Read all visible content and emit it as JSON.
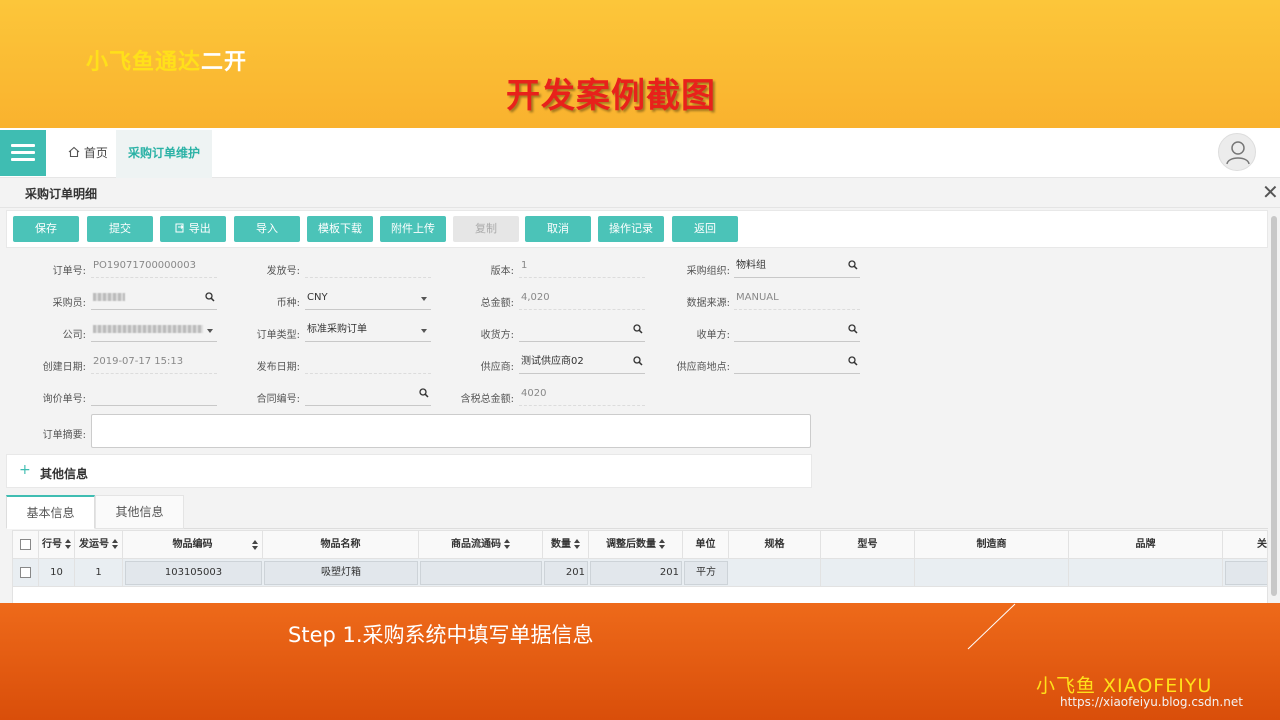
{
  "slide": {
    "brand_yellow": "小飞鱼通达",
    "brand_white": "二开",
    "title": "开发案例截图",
    "step_text": "Step 1.采购系统中填写单据信息",
    "bottom_brand": "小飞鱼  XIAOFEIYU",
    "watermark": "https://xiaofeiyu.blog.csdn.net"
  },
  "nav": {
    "home": "首页",
    "active_tab": "采购订单维护"
  },
  "page": {
    "title": "采购订单明细"
  },
  "toolbar": {
    "buttons": [
      {
        "label": "保存",
        "disabled": false
      },
      {
        "label": "提交",
        "disabled": false
      },
      {
        "label": "导出",
        "disabled": false
      },
      {
        "label": "导入",
        "disabled": false
      },
      {
        "label": "模板下载",
        "disabled": false
      },
      {
        "label": "附件上传",
        "disabled": false
      },
      {
        "label": "复制",
        "disabled": true
      },
      {
        "label": "取消",
        "disabled": false
      },
      {
        "label": "操作记录",
        "disabled": false
      },
      {
        "label": "返回",
        "disabled": false
      }
    ]
  },
  "form": {
    "order_no": {
      "label": "订单号:",
      "value": "PO19071700000003"
    },
    "release_no": {
      "label": "发放号:",
      "value": ""
    },
    "version": {
      "label": "版本:",
      "value": "1"
    },
    "purchase_org": {
      "label": "采购组织:",
      "value": "物料组"
    },
    "buyer": {
      "label": "采购员:",
      "value": ""
    },
    "currency": {
      "label": "币种:",
      "value": "CNY"
    },
    "total_amount": {
      "label": "总金额:",
      "value": "4,020"
    },
    "data_source": {
      "label": "数据来源:",
      "value": "MANUAL"
    },
    "company": {
      "label": "公司:",
      "value": ""
    },
    "order_type": {
      "label": "订单类型:",
      "value": "标准采购订单"
    },
    "receiver": {
      "label": "收货方:",
      "value": ""
    },
    "bill_to": {
      "label": "收单方:",
      "value": ""
    },
    "created_date": {
      "label": "创建日期:",
      "value": "2019-07-17 15:13"
    },
    "publish_date": {
      "label": "发布日期:",
      "value": ""
    },
    "supplier": {
      "label": "供应商:",
      "value": "测试供应商02"
    },
    "supplier_site": {
      "label": "供应商地点:",
      "value": ""
    },
    "inquiry_no": {
      "label": "询价单号:",
      "value": ""
    },
    "contract_no": {
      "label": "合同编号:",
      "value": ""
    },
    "tax_total": {
      "label": "含税总金额:",
      "value": "4020"
    },
    "summary": {
      "label": "订单摘要:",
      "value": ""
    }
  },
  "other_info": {
    "plus": "+",
    "label": "其他信息"
  },
  "tabs": [
    "基本信息",
    "其他信息"
  ],
  "grid": {
    "headers": [
      "行号",
      "发运号",
      "物品编码",
      "物品名称",
      "商品流通码",
      "数量",
      "调整后数量",
      "单位",
      "规格",
      "型号",
      "制造商",
      "品牌",
      "关"
    ],
    "rows": [
      [
        "10",
        "1",
        "103105003",
        "吸塑灯箱",
        "",
        "201",
        "201",
        "平方",
        "",
        "",
        "",
        "",
        ""
      ]
    ]
  }
}
